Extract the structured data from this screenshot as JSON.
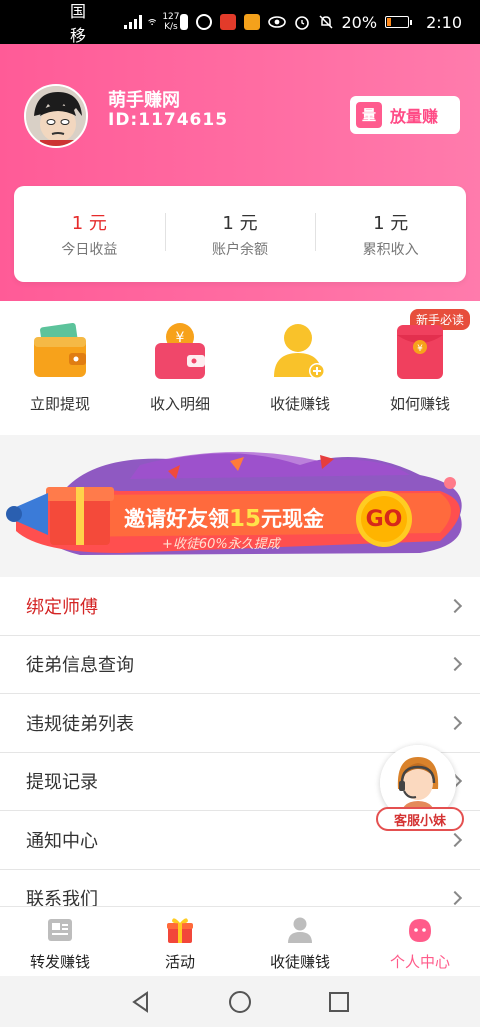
{
  "status_bar": {
    "carrier": "中国移动",
    "network": "4G",
    "speed_value": "127",
    "speed_unit": "K/s",
    "battery": "20%",
    "time": "2:10"
  },
  "profile": {
    "username": "萌手赚网",
    "user_id": "ID:1174615",
    "promo_label": "放量赚",
    "promo_logo": "量"
  },
  "stats": [
    {
      "value": "1 元",
      "label": "今日收益",
      "color": "#e62b2b"
    },
    {
      "value": "1 元",
      "label": "账户余额",
      "color": "#333333"
    },
    {
      "value": "1 元",
      "label": "累积收入",
      "color": "#333333"
    }
  ],
  "quick_actions": [
    {
      "label": "立即提现",
      "icon": "wallet-icon"
    },
    {
      "label": "收入明细",
      "icon": "coin-purse-icon"
    },
    {
      "label": "收徒赚钱",
      "icon": "add-user-icon"
    },
    {
      "label": "如何赚钱",
      "icon": "red-envelope-icon",
      "badge": "新手必读"
    }
  ],
  "banner": {
    "title_prefix": "邀请好友领",
    "title_amount": "15",
    "title_suffix": "元现金",
    "subtitle": "+收徒60%永久提成",
    "go_label": "GO"
  },
  "menu": [
    {
      "label": "绑定师傅",
      "highlight": true
    },
    {
      "label": "徒弟信息查询",
      "highlight": false
    },
    {
      "label": "违规徒弟列表",
      "highlight": false
    },
    {
      "label": "提现记录",
      "highlight": false
    },
    {
      "label": "通知中心",
      "highlight": false
    },
    {
      "label": "联系我们",
      "highlight": false
    }
  ],
  "customer_service": {
    "label": "客服小妹"
  },
  "tabbar": [
    {
      "label": "转发赚钱",
      "icon": "news-icon",
      "active": false
    },
    {
      "label": "活动",
      "icon": "gift-icon",
      "active": false
    },
    {
      "label": "收徒赚钱",
      "icon": "user-icon",
      "active": false
    },
    {
      "label": "个人中心",
      "icon": "face-icon",
      "active": true
    }
  ],
  "colors": {
    "brand_pink": "#ff5b97",
    "active_tab": "#ff5b8a",
    "highlight_red": "#d42525"
  }
}
